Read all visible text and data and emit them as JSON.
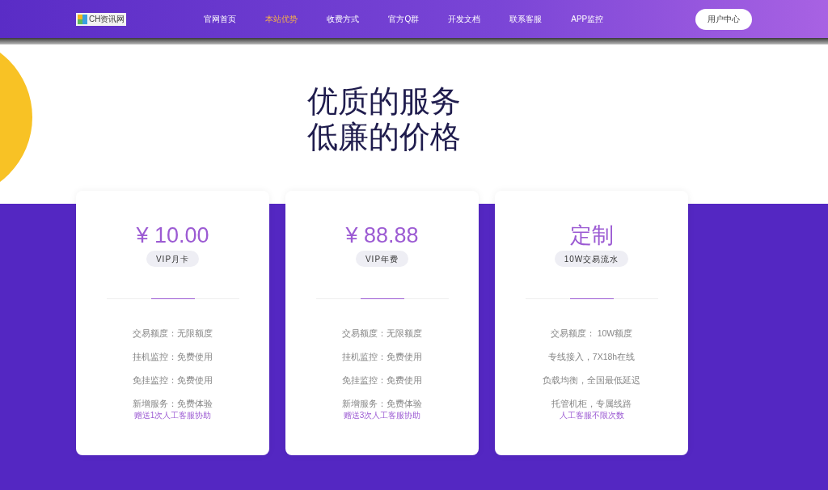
{
  "header": {
    "logo_text": "CH资讯网",
    "nav": [
      {
        "label": "官网首页",
        "selected": false
      },
      {
        "label": "本站优势",
        "selected": true
      },
      {
        "label": "收费方式",
        "selected": false
      },
      {
        "label": "官方Q群",
        "selected": false
      },
      {
        "label": "开发文档",
        "selected": false
      },
      {
        "label": "联系客服",
        "selected": false
      },
      {
        "label": "APP监控",
        "selected": false
      }
    ],
    "user_button": "用户中心"
  },
  "hero": {
    "title_lines": [
      "优质的服务",
      "低廉的价格"
    ]
  },
  "plans": [
    {
      "price": "¥ 10.00",
      "tag": "VIP月卡",
      "features": [
        "交易额度：无限额度",
        "挂机监控：免费使用",
        "免挂监控：免费使用",
        "新增服务：免费体验"
      ],
      "note": "赠送1次人工客服协助"
    },
    {
      "price": "¥ 88.88",
      "tag": "VIP年费",
      "features": [
        "交易额度：无限额度",
        "挂机监控：免费使用",
        "免挂监控：免费使用",
        "新增服务：免费体验"
      ],
      "note": "赠送3次人工客服协助"
    },
    {
      "price": "定制",
      "tag": "10W交易流水",
      "features": [
        "交易额度： 10W额度",
        "专线接入，7X18h在线",
        "负载均衡，全国最低延迟",
        "托管机柜，专属线路"
      ],
      "note": "人工客服不限次数"
    }
  ]
}
